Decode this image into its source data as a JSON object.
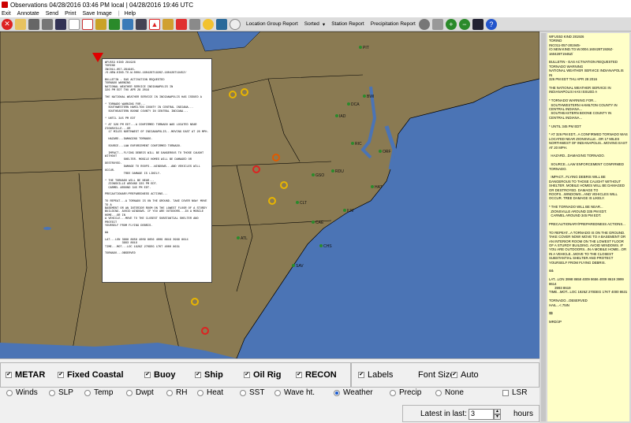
{
  "window": {
    "title": "Observations 04/28/2016 03:46 PM local  |  04/28/2016 19:46 UTC"
  },
  "menu": {
    "items": [
      "Exit",
      "Annotate",
      "Send",
      "Print",
      "Save Image",
      "|",
      "Help"
    ]
  },
  "toolbar": {
    "icons": [
      "exit-icon",
      "open-folder-icon",
      "ship-icon",
      "print-icon",
      "save-icon",
      "blank-page-icon",
      "pdf-icon",
      "signal-icon",
      "weather-icon",
      "map-layer-icon",
      "cloud-icon",
      "warning-icon",
      "chart-icon",
      "flag-icon",
      "grid-icon",
      "sun-icon",
      "weather2-icon",
      "clock-icon"
    ],
    "location_report": "Location Group Report",
    "sorted": "Sorted",
    "station_report": "Station Report",
    "precip_report": "Precipitation Report",
    "right_icons": [
      "globe-icon",
      "refresh-icon",
      "zoom-in-icon",
      "zoom-out-icon",
      "us-map-icon",
      "help-icon"
    ]
  },
  "popup": {
    "text": "WFUS53 KIND 281926\nTORIND\nINC011-057-281945-\n/O.NEW.KIND.TO.W.0004.160428T1926Z-160428T1945Z/\n\nBULLETIN - EAS ACTIVATION REQUESTED\nTORNADO WARNING\nNATIONAL WEATHER SERVICE INDIANAPOLIS IN\n326 PM EDT THU APR 28 2016\n\nTHE NATIONAL WEATHER SERVICE IN INDIANAPOLIS HAS ISSUED A\n\n* TORNADO WARNING FOR...\n  SOUTHWESTERN HAMILTON COUNTY IN CENTRAL INDIANA...\n  SOUTHEASTERN BOONE COUNTY IN CENTRAL INDIANA...\n\n* UNTIL 345 PM EDT\n\n* AT 326 PM EDT...A CONFIRMED TORNADO WAS LOCATED NEAR ZIONSVILLE...OR\n  17 MILES NORTHWEST OF INDIANAPOLIS...MOVING EAST AT 20 MPH.\n\n  HAZARD...DAMAGING TORNADO.\n\n  SOURCE...LAW ENFORCEMENT CONFIRMED TORNADO.\n\n  IMPACT...FLYING DEBRIS WILL BE DANGEROUS TO THOSE CAUGHT WITHOUT\n           SHELTER. MOBILE HOMES WILL BE DAMAGED OR DESTROYED.\n           DAMAGE TO ROOFS...WINDOWS...AND VEHICLES WILL OCCUR.\n           TREE DAMAGE IS LIKELY.\n\n* THE TORNADO WILL BE NEAR...\n  ZIONSVILLE AROUND 335 PM EDT.\n  CARMEL AROUND 345 PM EDT.\n\nPRECAUTIONARY/PREPAREDNESS ACTIONS...\n\nTO REPEAT...A TORNADO IS ON THE GROUND. TAKE COVER NOW! MOVE TO A\nBASEMENT OR AN INTERIOR ROOM ON THE LOWEST FLOOR OF A STURDY\nBUILDING. AVOID WINDOWS. IF YOU ARE OUTDOORS...IN A MOBILE HOME...OR IN\nA VEHICLE...MOVE TO THE CLOSEST SUBSTANTIAL SHELTER AND PROTECT\nYOURSELF FROM FLYING DEBRIS.\n\n&&\n\nLAT...LON 3998 8658 4009 8656 4009 8619 3999 8614\n          3993 8619\nTIME...MOT...LOC 1926Z 270DEG 17KT 4000 8631\n\nTORNADO...OBSERVED"
  },
  "sidepanel": {
    "text": "WFUS53 KIND 281926\nTORIND\nINC011-057-281945-\n/O.NEW.KIND.TO.W.0004.160428T1926Z-160428T1945Z/\n\nBULLETIN - EAS ACTIVATION REQUESTED\nTORNADO WARNING\nNATIONAL WEATHER SERVICE INDIANAPOLIS IN\n326 PM EDT THU APR 28 2016\n\nTHE NATIONAL WEATHER SERVICE IN INDIANAPOLIS HAS ISSUED A\n\n* TORNADO WARNING FOR...\n  SOUTHWESTERN HAMILTON COUNTY IN CENTRAL INDIANA...\n  SOUTHEASTERN BOONE COUNTY IN CENTRAL INDIANA...\n\n* UNTIL 345 PM EDT\n\n* AT 326 PM EDT...A CONFIRMED TORNADO WAS LOCATED NEAR ZIONSVILLE...OR 17 MILES NORTHWEST OF INDIANAPOLIS...MOVING EAST AT 20 MPH.\n\n  HAZARD...DAMAGING TORNADO.\n\n  SOURCE...LAW ENFORCEMENT CONFIRMED TORNADO.\n\n  IMPACT...FLYING DEBRIS WILL BE DANGEROUS TO THOSE CAUGHT WITHOUT SHELTER. MOBILE HOMES WILL BE DAMAGED OR DESTROYED. DAMAGE TO ROOFS...WINDOWS...AND VEHICLES WILL OCCUR. TREE DAMAGE IS LIKELY.\n\n* THE TORNADO WILL BE NEAR...\n  ZIONSVILLE AROUND 335 PM EDT.\n  CARMEL AROUND 345 PM EDT.\n\nPRECAUTIONARY/PREPAREDNESS ACTIONS...\n\nTO REPEAT...A TORNADO IS ON THE GROUND. TAKE COVER NOW! MOVE TO A BASEMENT OR AN INTERIOR ROOM ON THE LOWEST FLOOR OF A STURDY BUILDING. AVOID WINDOWS. IF YOU ARE OUTDOORS...IN A MOBILE HOME...OR IN A VEHICLE...MOVE TO THE CLOSEST SUBSTANTIAL SHELTER AND PROTECT YOURSELF FROM FLYING DEBRIS.\n\n&&\n\nLAT...LON 3998 8658 4009 8656 4009 8619 3999 8614\n      3993 8619\nTIME...MOT...LOC 1926Z 270DEG 17KT 4000 8631\n\nTORNADO...OBSERVED\nHAIL...<.75IN\n\n$$\n\nMRD/JP"
  },
  "platforms": {
    "metar": "METAR",
    "fixed_coastal": "Fixed Coastal",
    "buoy": "Buoy",
    "ship": "Ship",
    "oil_rig": "Oil Rig",
    "recon": "RECON"
  },
  "labels": {
    "labels": "Labels",
    "font_size": "Font Size:",
    "auto": "Auto"
  },
  "params": {
    "winds": "Winds",
    "slp": "SLP",
    "temp": "Temp",
    "dwpt": "Dwpt",
    "rh": "RH",
    "heat": "Heat",
    "sst": "SST",
    "wave": "Wave ht.",
    "weather": "Weather",
    "precip": "Precip",
    "none": "None",
    "lsr": "LSR"
  },
  "latest": {
    "label": "Latest in last:",
    "value": "3",
    "unit": "hours"
  },
  "map_labels": {
    "stations": [
      "DCA",
      "BWI",
      "RIC",
      "ORF",
      "RDU",
      "CLT",
      "ATL",
      "CHS",
      "ILM",
      "HAT",
      "PIT",
      "IAD",
      "GSO",
      "CAE",
      "SAV"
    ]
  }
}
